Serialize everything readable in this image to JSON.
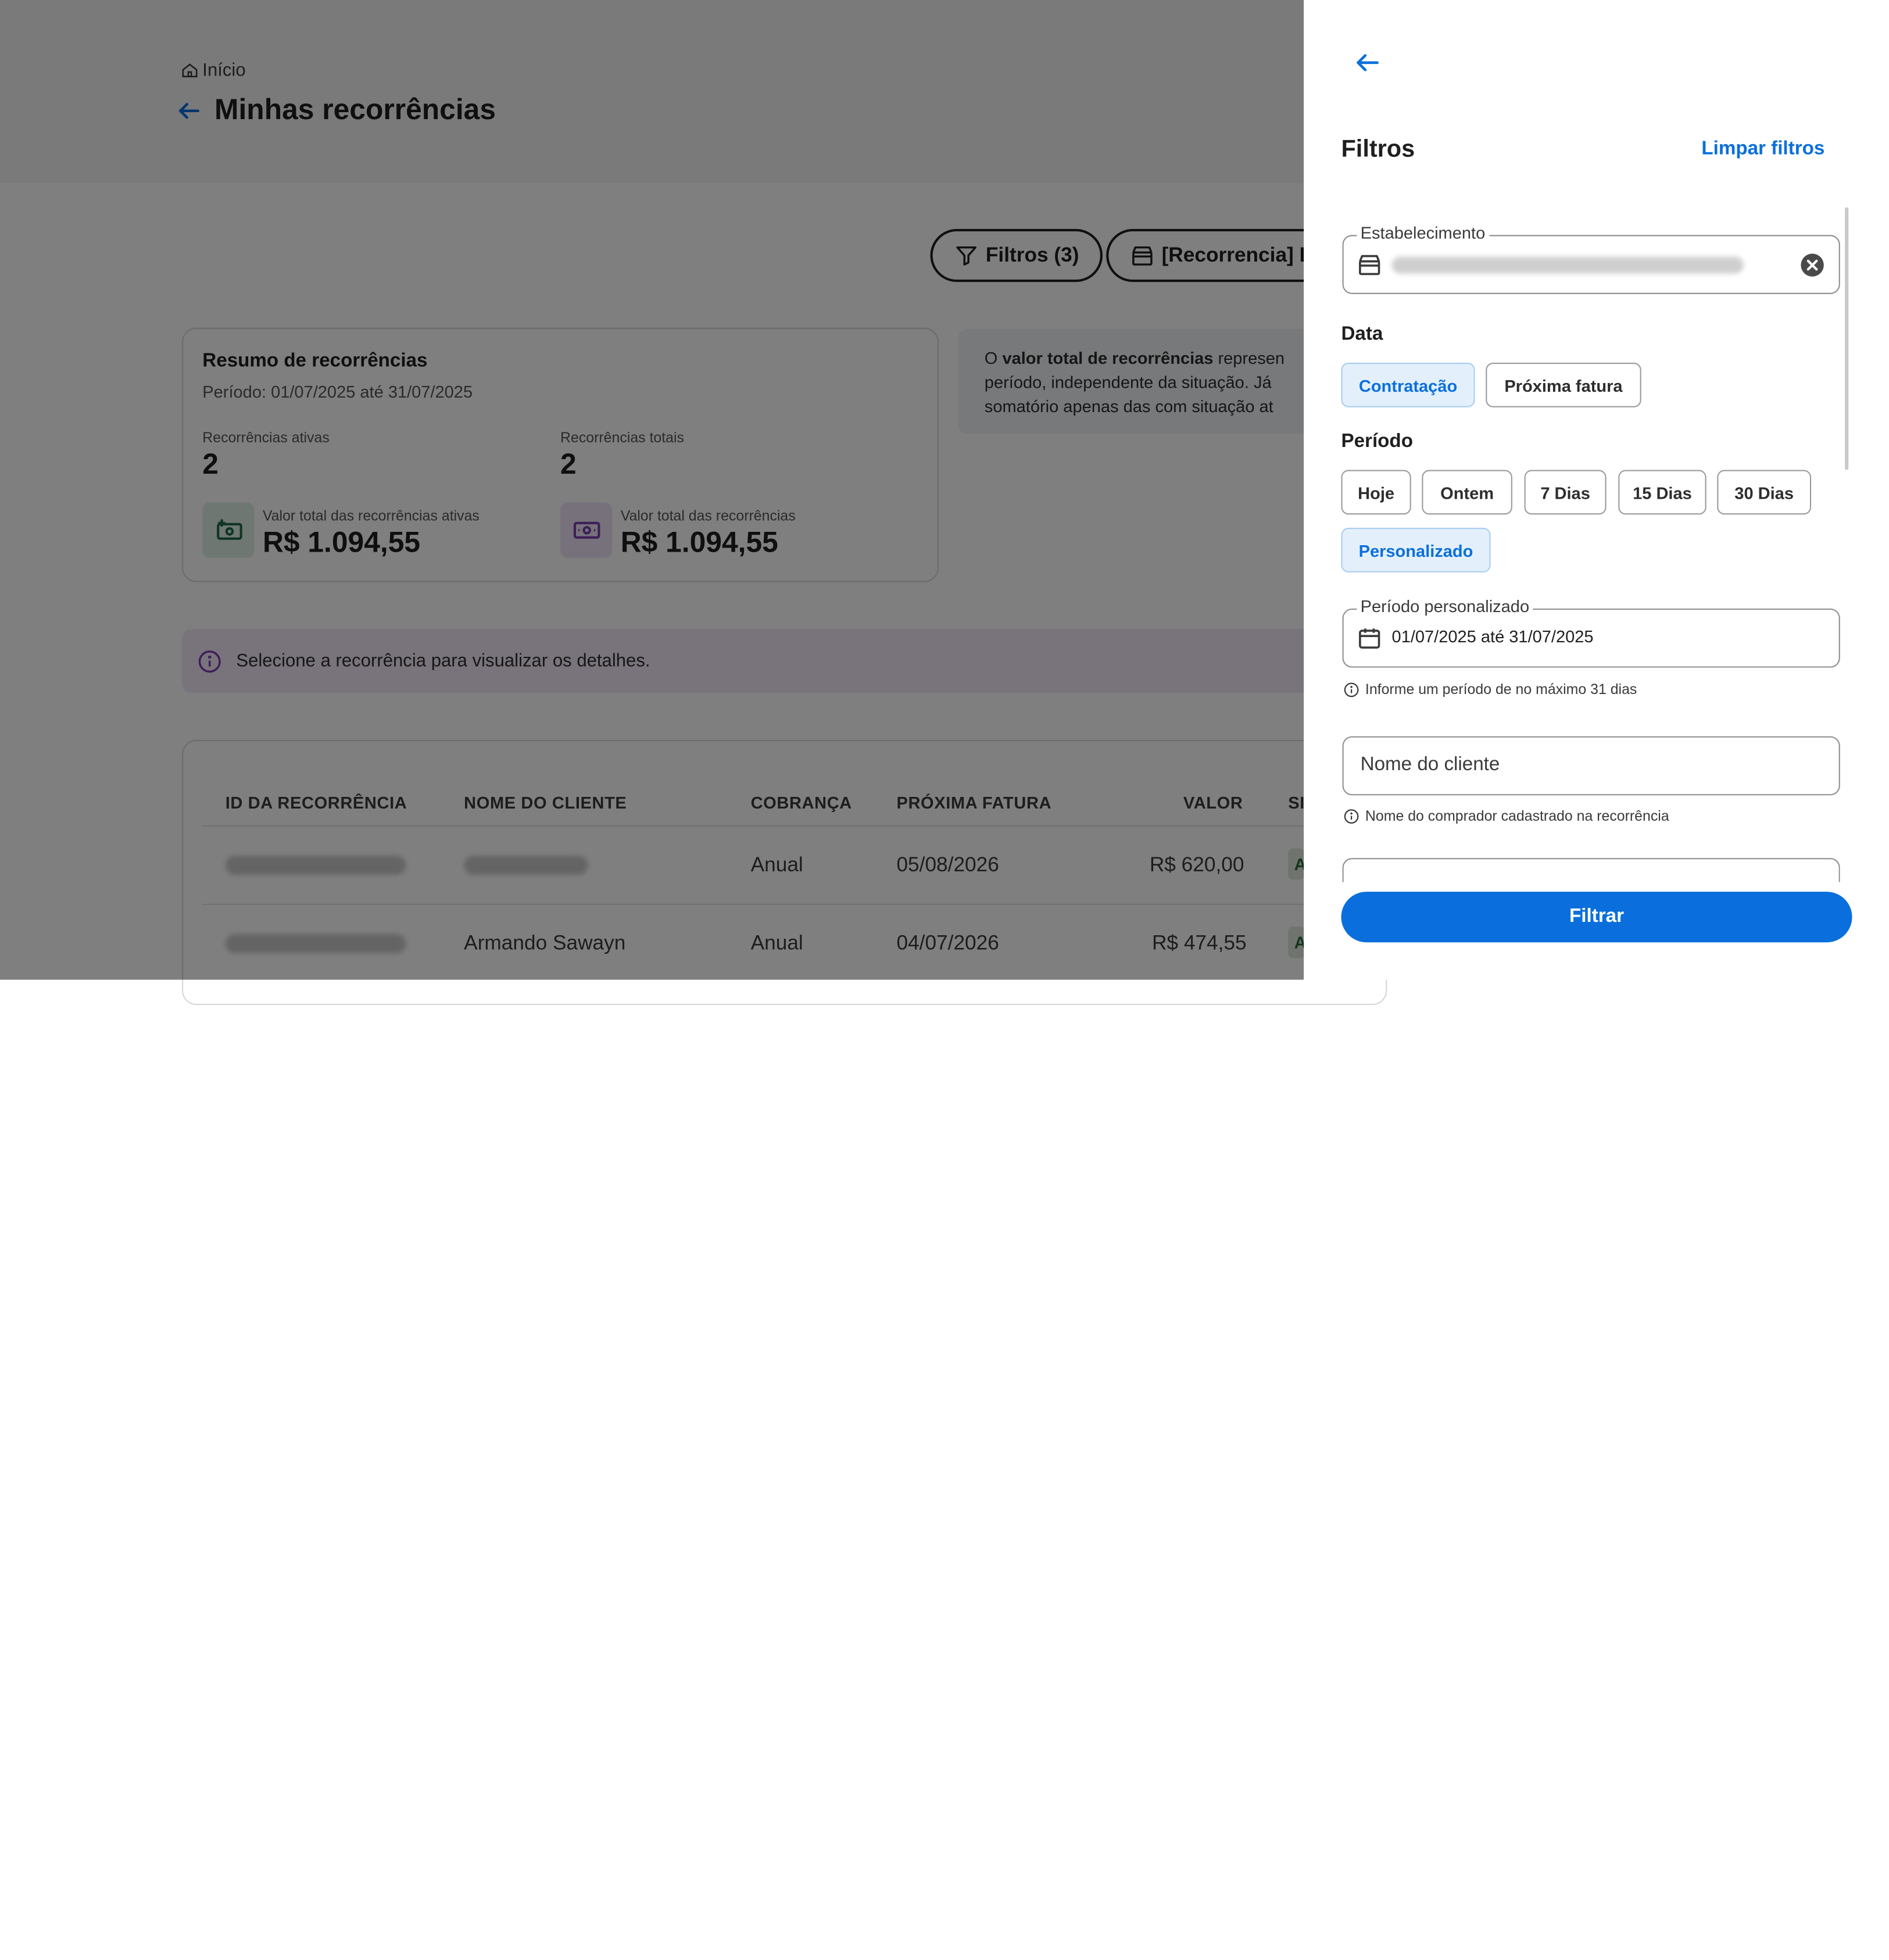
{
  "breadcrumb": {
    "home": "Início"
  },
  "page": {
    "title": "Minhas recorrências"
  },
  "toolbar": {
    "filters_label": "Filtros (3)",
    "store_label": "[Recorrencia] L"
  },
  "summary": {
    "title": "Resumo de recorrências",
    "period": "Período: 01/07/2025 até 31/07/2025",
    "active_label": "Recorrências ativas",
    "active_value": "2",
    "total_label": "Recorrências totais",
    "total_value": "2",
    "active_amount_label": "Valor total das recorrências ativas",
    "active_amount": "R$ 1.094,55",
    "total_amount_label": "Valor total das recorrências",
    "total_amount": "R$ 1.094,55"
  },
  "info": {
    "line1_prefix": "O ",
    "line1_bold": "valor total de recorrências",
    "line1_suffix": " represen",
    "line2": "período, independente da situação. Já",
    "line3": "somatório apenas das com situação at"
  },
  "alert": {
    "text": "Selecione a recorrência para visualizar os detalhes."
  },
  "table": {
    "columns": [
      "ID DA RECORRÊNCIA",
      "NOME DO CLIENTE",
      "COBRANÇA",
      "PRÓXIMA FATURA",
      "VALOR",
      "SI"
    ],
    "rows": [
      {
        "client": "",
        "billing": "Anual",
        "next_invoice": "05/08/2026",
        "value": "R$ 620,00",
        "status": "A"
      },
      {
        "client": "Armando Sawayn",
        "billing": "Anual",
        "next_invoice": "04/07/2026",
        "value": "R$ 474,55",
        "status": "A"
      }
    ]
  },
  "drawer": {
    "title": "Filtros",
    "clear_label": "Limpar filtros",
    "establishment": {
      "label": "Estabelecimento"
    },
    "date": {
      "label": "Data",
      "options": [
        "Contratação",
        "Próxima fatura"
      ],
      "selected": "Contratação"
    },
    "period": {
      "label": "Período",
      "options": [
        "Hoje",
        "Ontem",
        "7 Dias",
        "15 Dias",
        "30 Dias",
        "Personalizado"
      ],
      "selected": "Personalizado"
    },
    "custom_period": {
      "label": "Período personalizado",
      "value": "01/07/2025 até 31/07/2025",
      "hint": "Informe um período de no máximo 31 dias"
    },
    "client_name": {
      "placeholder": "Nome do cliente",
      "hint": "Nome do comprador cadastrado na recorrência"
    },
    "submit_label": "Filtrar"
  },
  "colors": {
    "accent": "#0a6fdc",
    "chip_selected_bg": "#e3f0fc",
    "alert_bg": "#f2e8f7",
    "overlay": "rgba(0,0,0,0.5)"
  },
  "icons": [
    "home-icon",
    "arrow-left-icon",
    "filter-icon",
    "store-icon",
    "cash-icon",
    "info-icon",
    "close-circle-icon",
    "calendar-icon"
  ]
}
